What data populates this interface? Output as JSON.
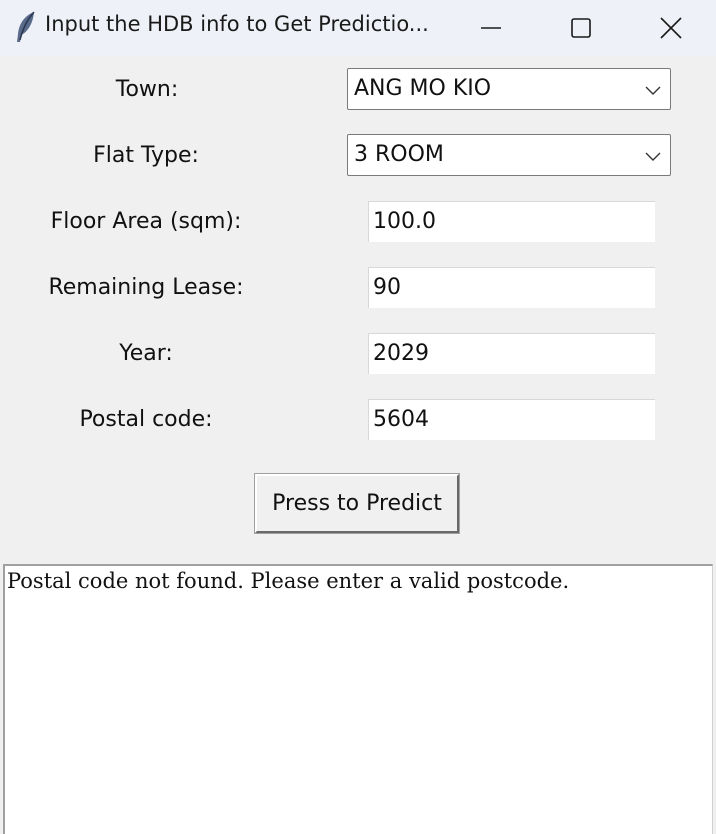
{
  "window": {
    "title": "Input the HDB info to Get Predictio...",
    "icons": {
      "app": "feather-icon",
      "minimize": "minimize-icon",
      "maximize": "maximize-icon",
      "close": "close-icon"
    }
  },
  "form": {
    "town": {
      "label": "Town:",
      "value": "ANG MO KIO"
    },
    "flat_type": {
      "label": "Flat Type:",
      "value": "3 ROOM"
    },
    "floor_area": {
      "label": "Floor Area (sqm):",
      "value": "100.0"
    },
    "remaining_lease": {
      "label": "Remaining Lease:",
      "value": "90"
    },
    "year": {
      "label": "Year:",
      "value": "2029"
    },
    "postal_code": {
      "label": "Postal code:",
      "value": "5604"
    }
  },
  "predict_button": {
    "label": "Press to Predict"
  },
  "output": {
    "text": "Postal code not found. Please enter a valid postcode."
  },
  "colors": {
    "background": "#f0f0f0",
    "titlebar": "#eef1f7",
    "field": "#ffffff"
  }
}
